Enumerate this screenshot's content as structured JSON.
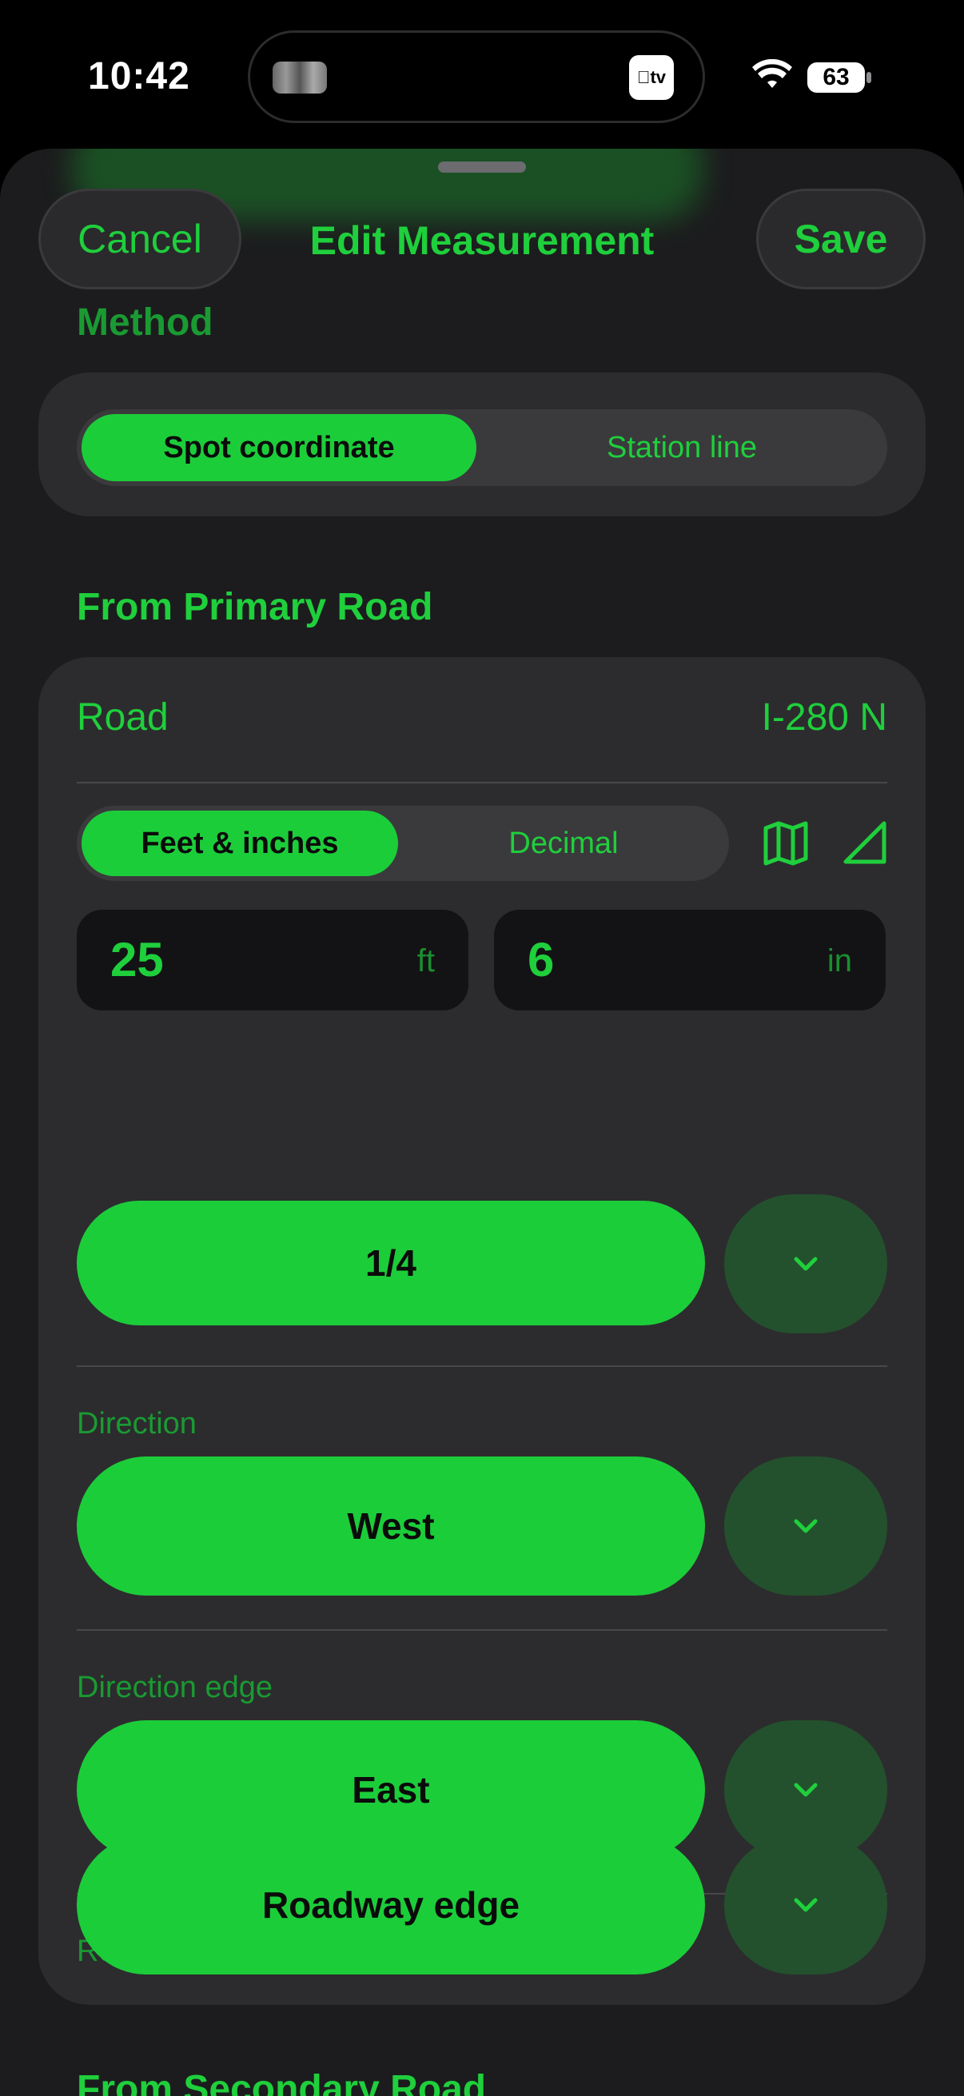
{
  "status_bar": {
    "time": "10:42",
    "battery": "63",
    "tv_label": "tv"
  },
  "nav": {
    "cancel_label": "Cancel",
    "title": "Edit Measurement",
    "save_label": "Save"
  },
  "method": {
    "heading": "Method",
    "options": [
      "Spot coordinate",
      "Station line"
    ],
    "selected": "Spot coordinate"
  },
  "primary": {
    "heading": "From Primary Road",
    "road_label": "Road",
    "road_value": "I-280 N",
    "unit_options": [
      "Feet & inches",
      "Decimal"
    ],
    "unit_selected": "Feet & inches",
    "feet_value": "25",
    "feet_unit": "ft",
    "inches_value": "6",
    "inches_unit": "in",
    "fraction": "1/4",
    "direction_label": "Direction",
    "direction_value": "West",
    "direction_edge_label": "Direction edge",
    "direction_edge_value": "East",
    "road_edge_label": "Road edge",
    "road_edge_value": "Roadway edge",
    "icons": [
      "map-icon",
      "triangle-ruler-icon"
    ]
  },
  "secondary": {
    "heading": "From Secondary Road"
  },
  "colors": {
    "accent": "#1ccd3a",
    "background": "#1c1c1e",
    "card": "#2c2c2e",
    "dark_green": "#23512d"
  }
}
